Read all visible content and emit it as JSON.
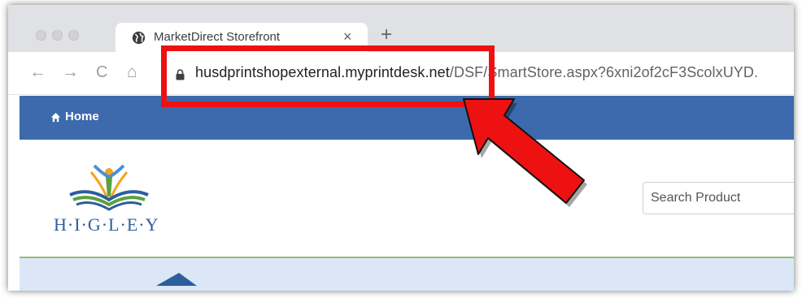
{
  "browser": {
    "tab_title": "MarketDirect Storefront",
    "tab_close": "×",
    "new_tab": "+",
    "nav": {
      "back": "←",
      "forward": "→",
      "reload": "C",
      "home": "⌂"
    },
    "url_host": "husdprintshopexternal.myprintdesk.net",
    "url_path": "/DSF/SmartStore.aspx?6xni2of2cF3ScolxUYD."
  },
  "site": {
    "nav_home": "Home",
    "logo_text": "H·I·G·L·E·Y",
    "search_placeholder": "Search Product"
  },
  "colors": {
    "nav_bar": "#3d6aad",
    "annotation": "#ee1111",
    "banner": "#dbe7f6"
  },
  "icons": [
    "globe-icon",
    "close-icon",
    "plus-icon",
    "back-icon",
    "forward-icon",
    "reload-icon",
    "home-icon",
    "lock-icon",
    "arrow-annotation"
  ]
}
